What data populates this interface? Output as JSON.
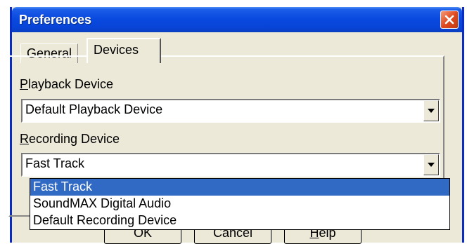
{
  "window": {
    "title": "Preferences",
    "close_icon": "close-icon"
  },
  "tabs": [
    {
      "label": "General",
      "active": false
    },
    {
      "label": "Devices",
      "active": true
    }
  ],
  "playback": {
    "label_mnemonic": "P",
    "label_rest": "layback Device",
    "value": "Default Playback Device"
  },
  "recording": {
    "label_mnemonic": "R",
    "label_rest": "ecording Device",
    "value": "Fast Track",
    "options": [
      "Fast Track",
      "SoundMAX Digital Audio",
      "Default Recording Device"
    ],
    "highlighted_option": "Fast Track"
  },
  "buttons": {
    "ok": "OK",
    "cancel": "Cancel",
    "help_mnemonic": "H",
    "help_rest": "elp"
  },
  "colors": {
    "titlebar": "#0a4adf",
    "selection": "#316ac5",
    "close_button": "#e04a20",
    "dialog_background": "#ece9d8"
  }
}
